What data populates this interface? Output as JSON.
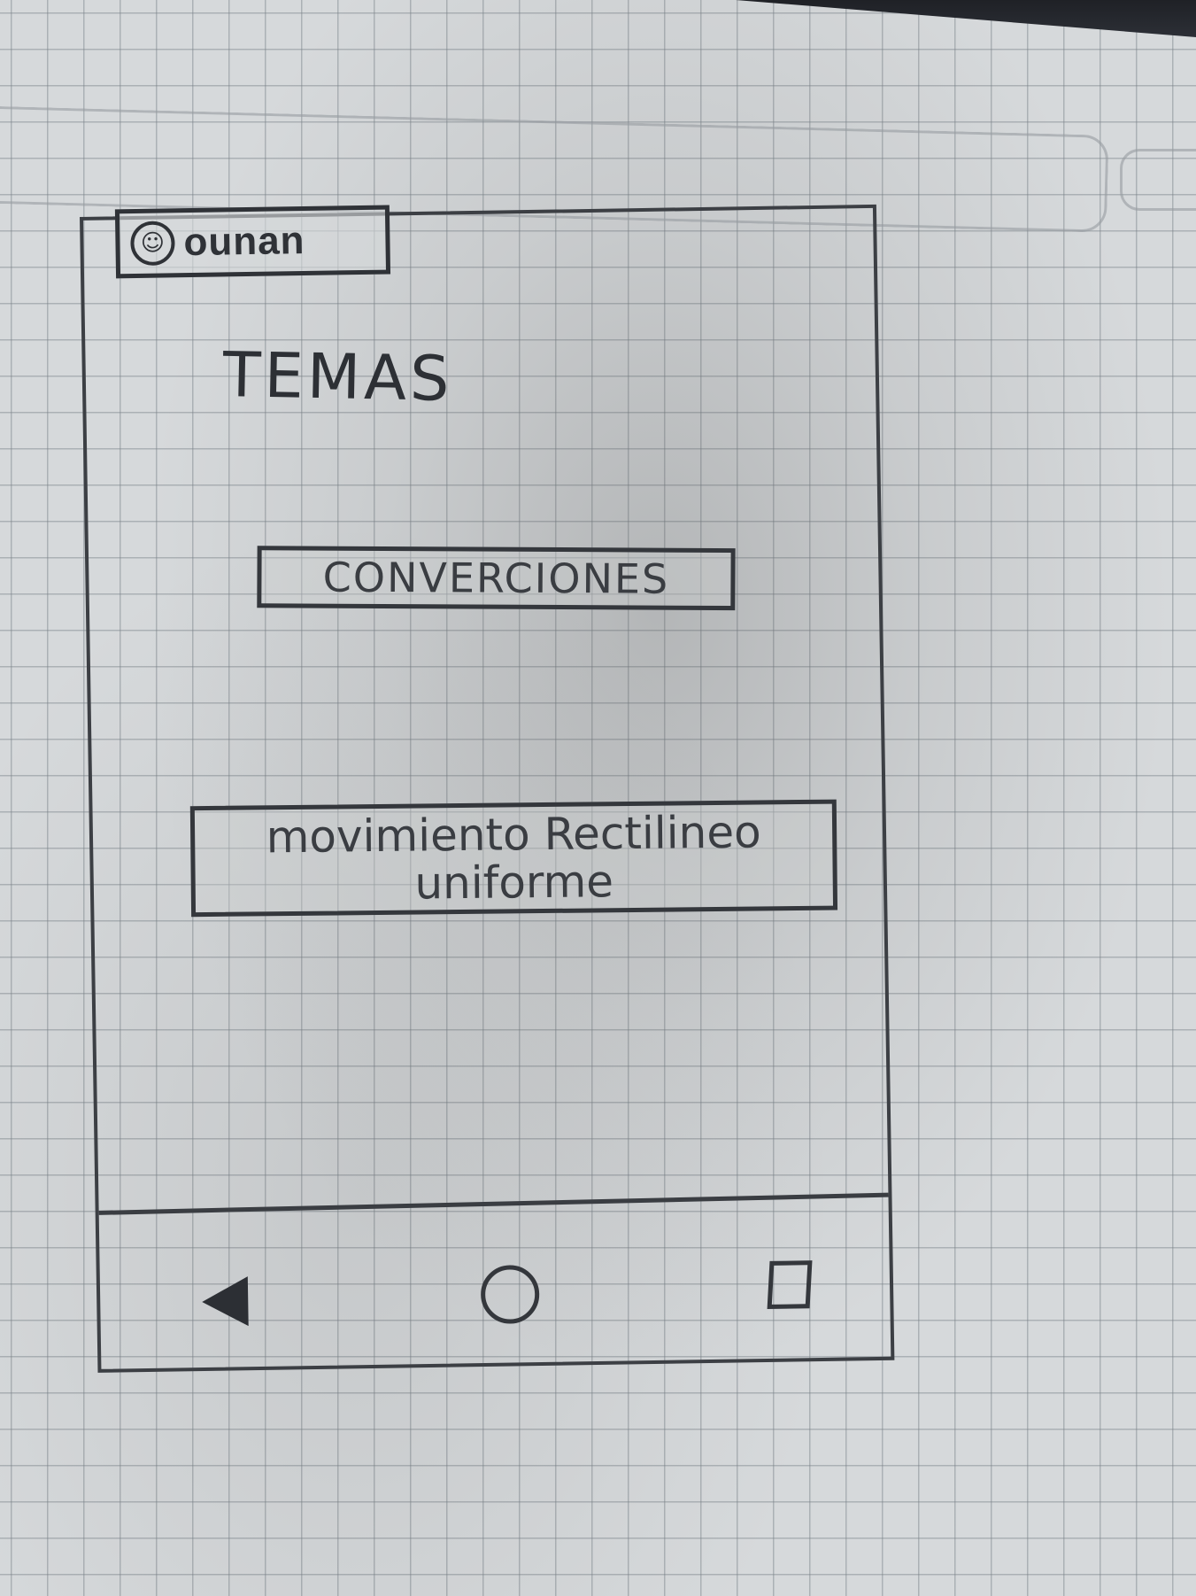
{
  "app": {
    "icon_name": "app-logo-icon",
    "name": "ounan"
  },
  "screen": {
    "title": "TEMAS"
  },
  "topics": [
    {
      "label": "CONVERCIONES"
    },
    {
      "label": "movimiento Rectilineo uniforme"
    }
  ],
  "navigation": {
    "back_icon": "back-triangle-icon",
    "home_icon": "home-circle-icon",
    "recent_icon": "recent-apps-square-icon"
  },
  "colors": {
    "ink": "#34373c",
    "paper": "#d6d9db"
  }
}
